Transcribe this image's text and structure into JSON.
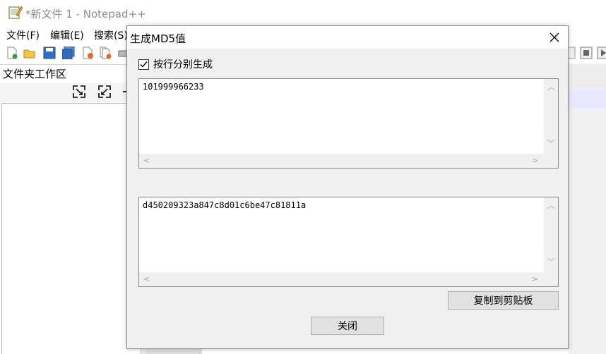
{
  "window": {
    "title": "*新文件 1 - Notepad++",
    "menu": [
      "文件(F)",
      "编辑(E)",
      "搜索(S)"
    ]
  },
  "panel": {
    "title": "文件夹工作区"
  },
  "dialog": {
    "title": "生成MD5值",
    "checkbox_label": "按行分别生成",
    "checkbox_checked": true,
    "input_text": "101999966233",
    "output_text": "d450209323a847c8d01c6be47c81811a",
    "copy_button": "复制到剪贴板",
    "close_button": "关闭"
  },
  "colors": {
    "dialog_bg": "#f0f0f0",
    "title_dim": "#8c8c8c",
    "highlight_line": "#e8e8ff"
  }
}
